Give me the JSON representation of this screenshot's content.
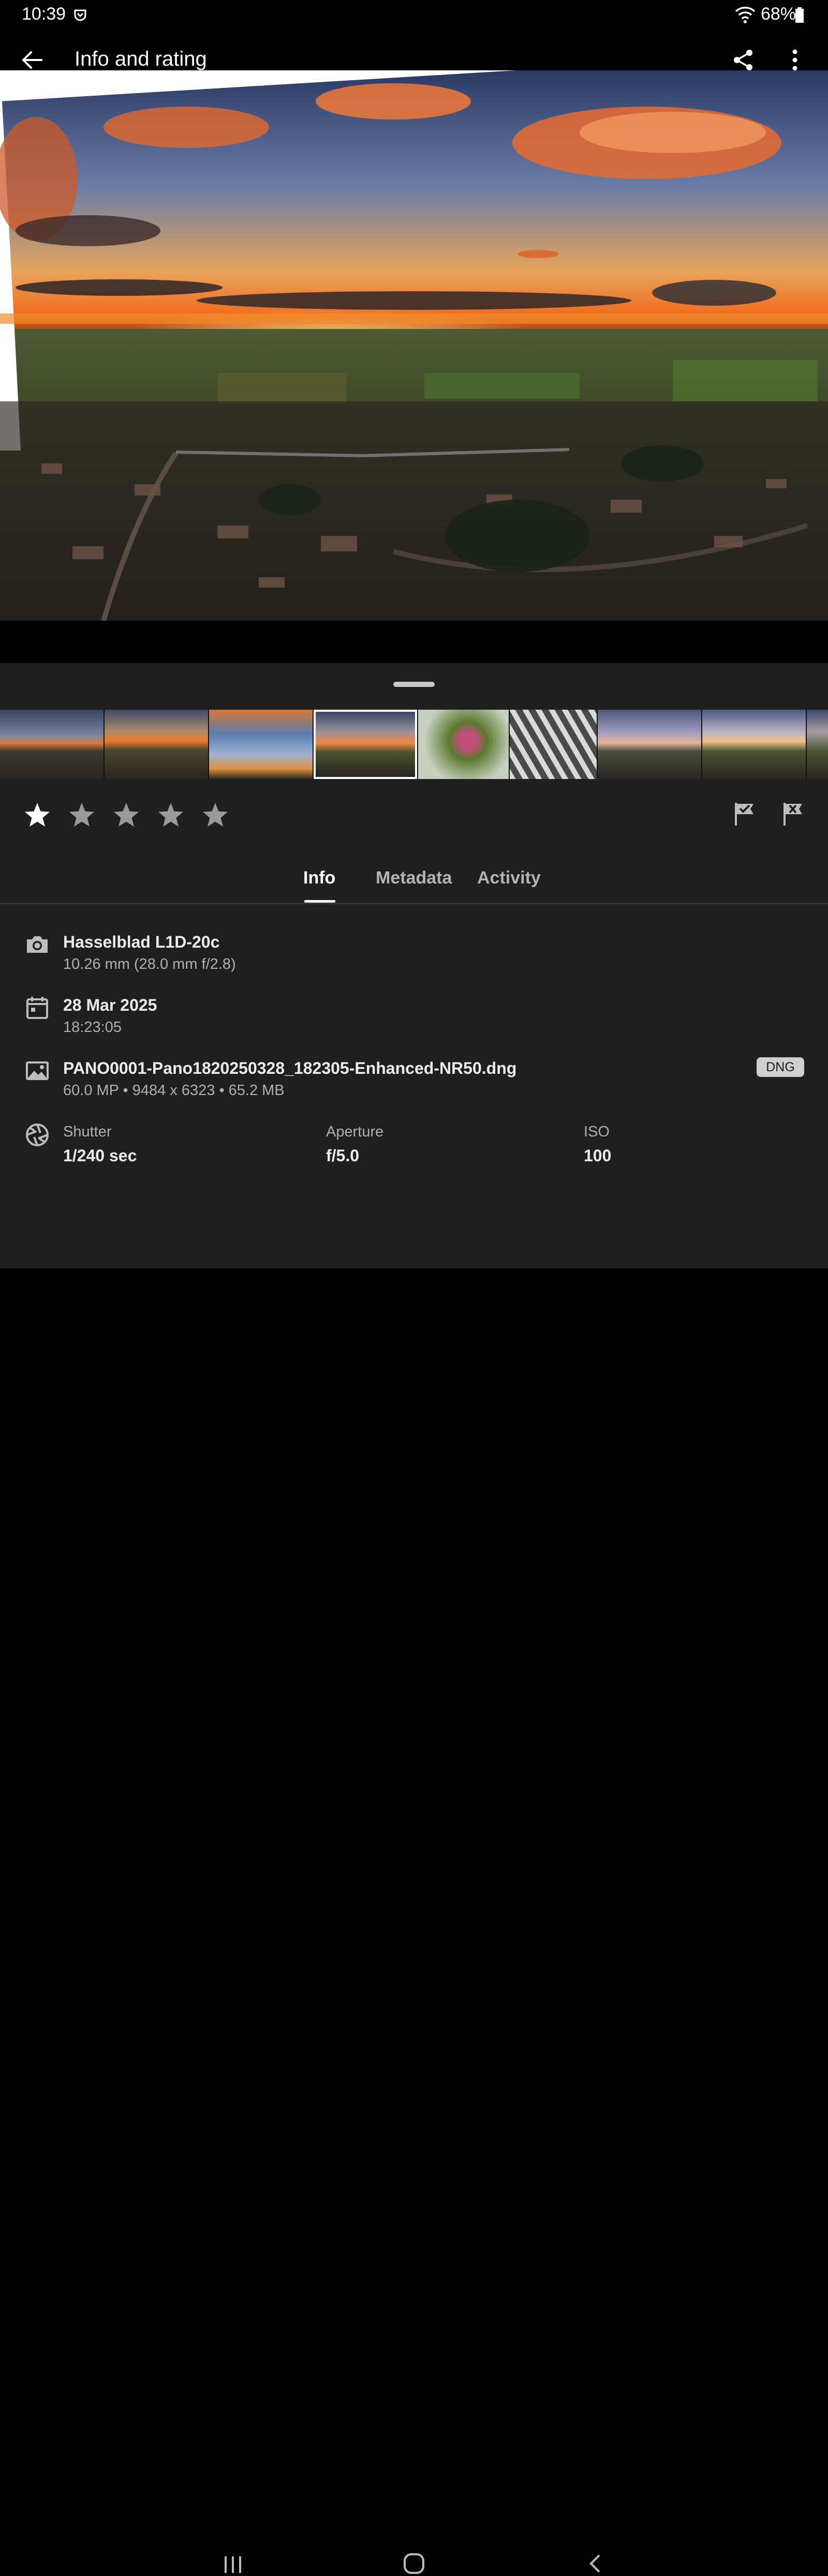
{
  "status_bar": {
    "time": "10:39",
    "battery": "68%"
  },
  "app_bar": {
    "title": "Info and rating"
  },
  "icons": {
    "back": "back-arrow-icon",
    "share": "share-icon",
    "more": "more-vert-icon",
    "camera": "camera-icon",
    "calendar": "calendar-icon",
    "image": "image-icon",
    "aperture": "aperture-icon",
    "flag_pick": "flag-pick-icon",
    "flag_reject": "flag-reject-icon"
  },
  "rating": {
    "stars_total": 5,
    "stars_filled": 1
  },
  "tabs": [
    {
      "label": "Info",
      "active": true
    },
    {
      "label": "Metadata",
      "active": false
    },
    {
      "label": "Activity",
      "active": false
    }
  ],
  "info": {
    "camera": {
      "model": "Hasselblad L1D-20c",
      "lens": "10.26 mm (28.0 mm f/2.8)"
    },
    "date": {
      "date": "28 Mar 2025",
      "time": "18:23:05"
    },
    "file": {
      "name": "PANO0001-Pano1820250328_182305-Enhanced-NR50.dng",
      "details": "60.0 MP • 9484 x 6323 • 65.2 MB",
      "badge": "DNG"
    },
    "exposure": {
      "shutter_label": "Shutter",
      "shutter_value": "1/240 sec",
      "aperture_label": "Aperture",
      "aperture_value": "f/5.0",
      "iso_label": "ISO",
      "iso_value": "100"
    }
  },
  "filmstrip": {
    "count": 9,
    "selected_index": 3
  }
}
